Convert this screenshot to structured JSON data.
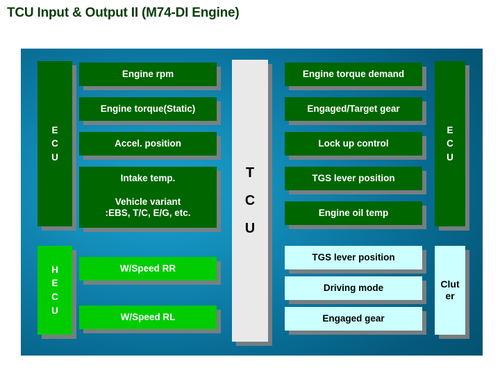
{
  "title": "TCU Input & Output II (M74-DI Engine)",
  "colors": {
    "title_text": "#0a3d0a",
    "panel_bg_center": "#1a9ec9",
    "panel_bg_edge": "#04506f",
    "green_dark": "#006600",
    "green_bright": "#00cc00",
    "cyan_light": "#ccffff",
    "gray_tcu": "#e9e9e9",
    "shadow": "#808080"
  },
  "diagram": {
    "center_unit": {
      "label": "T\nC\nU",
      "lines": [
        "T",
        "C",
        "U"
      ]
    },
    "left_column_units": [
      {
        "name": "ecu-left",
        "label": "E\nC\nU",
        "lines": [
          "E",
          "C",
          "U"
        ],
        "style": "green-dark"
      },
      {
        "name": "hecu-left",
        "label": "H\nE\nC\nU",
        "lines": [
          "H",
          "E",
          "C",
          "U"
        ],
        "style": "green-bright"
      }
    ],
    "right_column_units": [
      {
        "name": "ecu-right",
        "label": "E\nC\nU",
        "lines": [
          "E",
          "C",
          "U"
        ],
        "style": "green-dark"
      },
      {
        "name": "cluster-right",
        "label": "Cluter",
        "lines": [
          "Clut",
          "er"
        ],
        "style": "cyan-light"
      }
    ],
    "inputs_ecu": [
      "Engine rpm",
      "Engine torque(Static)",
      "Accel. position",
      "Intake temp.",
      "Vehicle variant\n:EBS, T/C, E/G, etc."
    ],
    "inputs_hecu": [
      "W/Speed RR",
      "W/Speed RL"
    ],
    "outputs_ecu": [
      "Engine torque demand",
      "Engaged/Target gear",
      "Lock up control",
      "TGS lever position",
      "Engine oil temp"
    ],
    "outputs_cluster": [
      "TGS lever position",
      "Driving mode",
      "Engaged gear"
    ]
  }
}
